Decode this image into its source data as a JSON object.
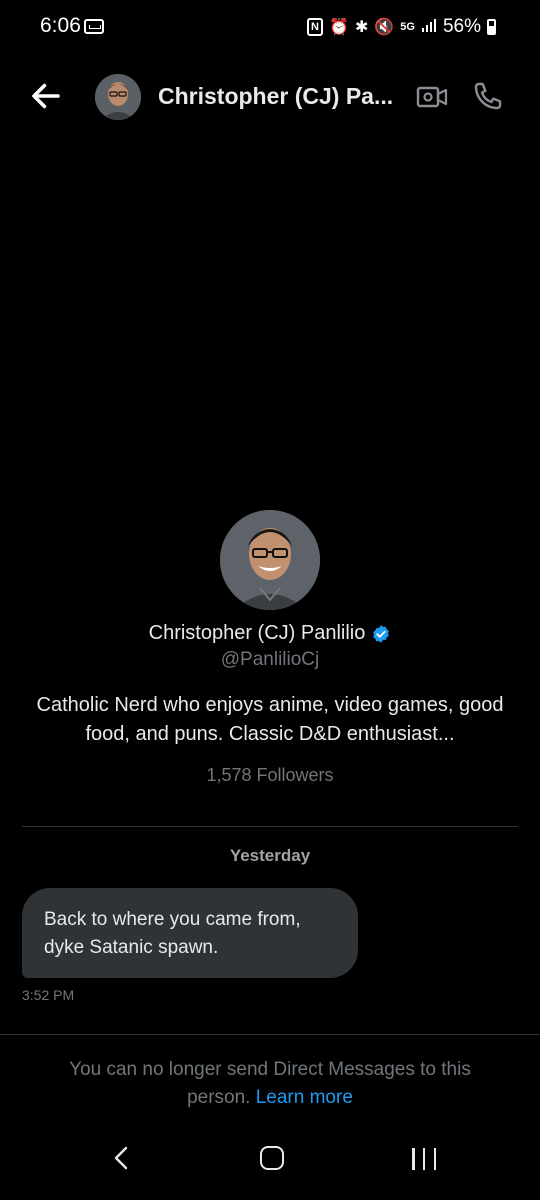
{
  "status_bar": {
    "time": "6:06",
    "network": "5G",
    "battery": "56%"
  },
  "header": {
    "contact_name": "Christopher (CJ) Pa..."
  },
  "profile": {
    "name": "Christopher (CJ) Panlilio",
    "handle": "@PanlilioCj",
    "bio": "Catholic Nerd who enjoys anime, video games, good food, and puns. Classic D&D enthusiast...",
    "followers": "1,578 Followers",
    "verified": true,
    "verified_color": "#1d9bf0"
  },
  "conversation": {
    "date_label": "Yesterday",
    "messages": [
      {
        "text": "Back to where you came from, dyke Satanic spawn.",
        "time": "3:52 PM"
      }
    ]
  },
  "notice": {
    "text": "You can no longer send Direct Messages to this person.",
    "link": "Learn more",
    "link_color": "#1d9bf0"
  },
  "icons": {
    "back": "arrow-left-icon",
    "video": "video-camera-icon",
    "call": "phone-icon",
    "verified": "verified-badge-icon",
    "nav_back": "chevron-left-icon",
    "nav_home": "home-icon",
    "nav_recents": "recents-icon"
  }
}
